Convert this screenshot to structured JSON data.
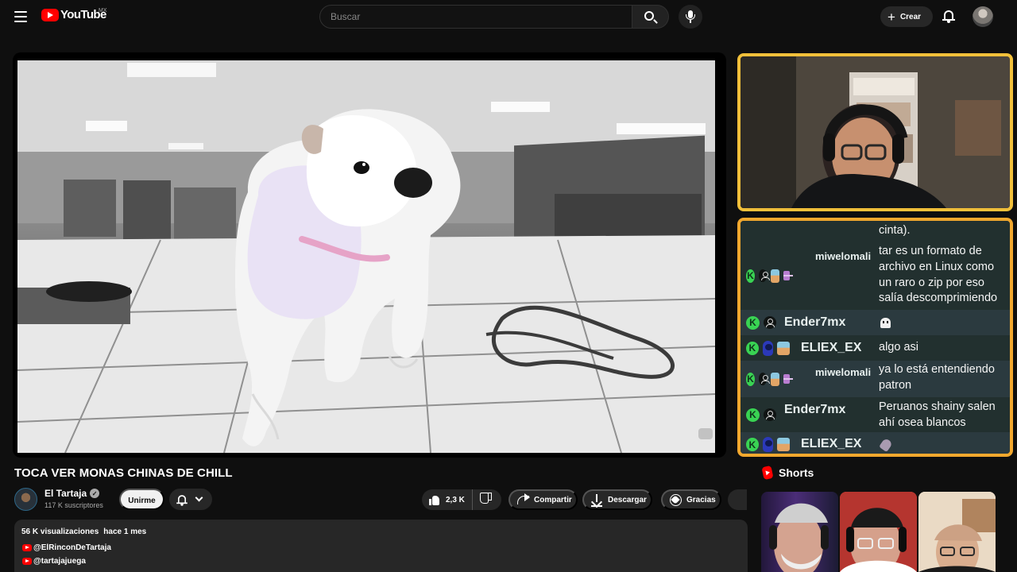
{
  "header": {
    "logo_text": "YouTube",
    "country_code": "MX",
    "search_placeholder": "Buscar",
    "create_label": "Crear",
    "icons": [
      "menu-icon",
      "search-icon",
      "microphone-icon",
      "plus-icon",
      "bell-icon",
      "user-avatar"
    ]
  },
  "video": {
    "title": "TOCA VER MONAS CHINAS DE CHILL",
    "channel": {
      "name": "El Tartaja",
      "subscribers": "117 K suscriptores",
      "join_label": "Unirme"
    },
    "actions": {
      "likes": "2,3 K",
      "share_label": "Compartir",
      "download_label": "Descargar",
      "thanks_label": "Gracias"
    },
    "description": {
      "views": "56 K visualizaciones",
      "age": "hace 1 mes",
      "links": [
        "@ElRinconDeTartaja",
        "@tartajajuega"
      ]
    }
  },
  "stream_overlay": {
    "chat": [
      {
        "user": "",
        "text": "cinta)."
      },
      {
        "user": "miwelomali",
        "text": "tar es un formato de archivo en Linux como un raro o zip por eso salía descomprimiendo"
      },
      {
        "user": "Ender7mx",
        "text": "",
        "emote": "ghost-emote"
      },
      {
        "user": "ELIEX_EX",
        "text": "algo asi"
      },
      {
        "user": "miwelomali",
        "text": "ya lo está entendiendo patron"
      },
      {
        "user": "Ender7mx",
        "text": "Peruanos shainy salen ahí osea blancos"
      },
      {
        "user": "ELIEX_EX",
        "text": "",
        "emote": "rocket-emote"
      }
    ],
    "frame_colors": {
      "webcam": "#f2c03a",
      "chat": "#f2a82e"
    }
  },
  "shorts": {
    "heading": "Shorts"
  }
}
